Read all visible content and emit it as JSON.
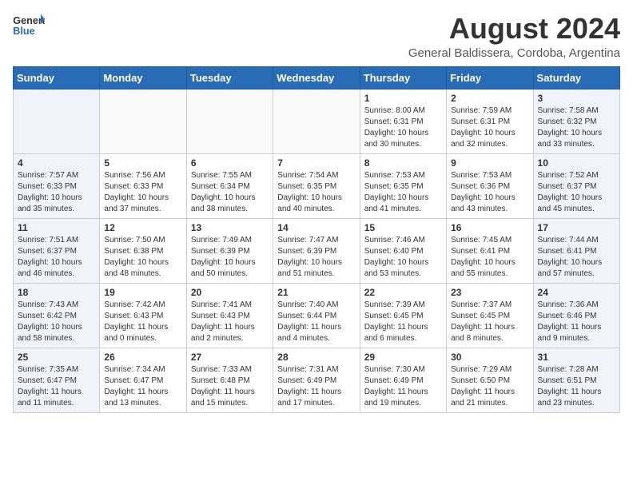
{
  "header": {
    "logo_general": "General",
    "logo_blue": "Blue",
    "main_title": "August 2024",
    "subtitle": "General Baldissera, Cordoba, Argentina"
  },
  "calendar": {
    "days_of_week": [
      "Sunday",
      "Monday",
      "Tuesday",
      "Wednesday",
      "Thursday",
      "Friday",
      "Saturday"
    ],
    "weeks": [
      [
        {
          "day": "",
          "info": ""
        },
        {
          "day": "",
          "info": ""
        },
        {
          "day": "",
          "info": ""
        },
        {
          "day": "",
          "info": ""
        },
        {
          "day": "1",
          "info": "Sunrise: 8:00 AM\nSunset: 6:31 PM\nDaylight: 10 hours\nand 30 minutes."
        },
        {
          "day": "2",
          "info": "Sunrise: 7:59 AM\nSunset: 6:31 PM\nDaylight: 10 hours\nand 32 minutes."
        },
        {
          "day": "3",
          "info": "Sunrise: 7:58 AM\nSunset: 6:32 PM\nDaylight: 10 hours\nand 33 minutes."
        }
      ],
      [
        {
          "day": "4",
          "info": "Sunrise: 7:57 AM\nSunset: 6:33 PM\nDaylight: 10 hours\nand 35 minutes."
        },
        {
          "day": "5",
          "info": "Sunrise: 7:56 AM\nSunset: 6:33 PM\nDaylight: 10 hours\nand 37 minutes."
        },
        {
          "day": "6",
          "info": "Sunrise: 7:55 AM\nSunset: 6:34 PM\nDaylight: 10 hours\nand 38 minutes."
        },
        {
          "day": "7",
          "info": "Sunrise: 7:54 AM\nSunset: 6:35 PM\nDaylight: 10 hours\nand 40 minutes."
        },
        {
          "day": "8",
          "info": "Sunrise: 7:53 AM\nSunset: 6:35 PM\nDaylight: 10 hours\nand 41 minutes."
        },
        {
          "day": "9",
          "info": "Sunrise: 7:53 AM\nSunset: 6:36 PM\nDaylight: 10 hours\nand 43 minutes."
        },
        {
          "day": "10",
          "info": "Sunrise: 7:52 AM\nSunset: 6:37 PM\nDaylight: 10 hours\nand 45 minutes."
        }
      ],
      [
        {
          "day": "11",
          "info": "Sunrise: 7:51 AM\nSunset: 6:37 PM\nDaylight: 10 hours\nand 46 minutes."
        },
        {
          "day": "12",
          "info": "Sunrise: 7:50 AM\nSunset: 6:38 PM\nDaylight: 10 hours\nand 48 minutes."
        },
        {
          "day": "13",
          "info": "Sunrise: 7:49 AM\nSunset: 6:39 PM\nDaylight: 10 hours\nand 50 minutes."
        },
        {
          "day": "14",
          "info": "Sunrise: 7:47 AM\nSunset: 6:39 PM\nDaylight: 10 hours\nand 51 minutes."
        },
        {
          "day": "15",
          "info": "Sunrise: 7:46 AM\nSunset: 6:40 PM\nDaylight: 10 hours\nand 53 minutes."
        },
        {
          "day": "16",
          "info": "Sunrise: 7:45 AM\nSunset: 6:41 PM\nDaylight: 10 hours\nand 55 minutes."
        },
        {
          "day": "17",
          "info": "Sunrise: 7:44 AM\nSunset: 6:41 PM\nDaylight: 10 hours\nand 57 minutes."
        }
      ],
      [
        {
          "day": "18",
          "info": "Sunrise: 7:43 AM\nSunset: 6:42 PM\nDaylight: 10 hours\nand 58 minutes."
        },
        {
          "day": "19",
          "info": "Sunrise: 7:42 AM\nSunset: 6:43 PM\nDaylight: 11 hours\nand 0 minutes."
        },
        {
          "day": "20",
          "info": "Sunrise: 7:41 AM\nSunset: 6:43 PM\nDaylight: 11 hours\nand 2 minutes."
        },
        {
          "day": "21",
          "info": "Sunrise: 7:40 AM\nSunset: 6:44 PM\nDaylight: 11 hours\nand 4 minutes."
        },
        {
          "day": "22",
          "info": "Sunrise: 7:39 AM\nSunset: 6:45 PM\nDaylight: 11 hours\nand 6 minutes."
        },
        {
          "day": "23",
          "info": "Sunrise: 7:37 AM\nSunset: 6:45 PM\nDaylight: 11 hours\nand 8 minutes."
        },
        {
          "day": "24",
          "info": "Sunrise: 7:36 AM\nSunset: 6:46 PM\nDaylight: 11 hours\nand 9 minutes."
        }
      ],
      [
        {
          "day": "25",
          "info": "Sunrise: 7:35 AM\nSunset: 6:47 PM\nDaylight: 11 hours\nand 11 minutes."
        },
        {
          "day": "26",
          "info": "Sunrise: 7:34 AM\nSunset: 6:47 PM\nDaylight: 11 hours\nand 13 minutes."
        },
        {
          "day": "27",
          "info": "Sunrise: 7:33 AM\nSunset: 6:48 PM\nDaylight: 11 hours\nand 15 minutes."
        },
        {
          "day": "28",
          "info": "Sunrise: 7:31 AM\nSunset: 6:49 PM\nDaylight: 11 hours\nand 17 minutes."
        },
        {
          "day": "29",
          "info": "Sunrise: 7:30 AM\nSunset: 6:49 PM\nDaylight: 11 hours\nand 19 minutes."
        },
        {
          "day": "30",
          "info": "Sunrise: 7:29 AM\nSunset: 6:50 PM\nDaylight: 11 hours\nand 21 minutes."
        },
        {
          "day": "31",
          "info": "Sunrise: 7:28 AM\nSunset: 6:51 PM\nDaylight: 11 hours\nand 23 minutes."
        }
      ]
    ]
  }
}
